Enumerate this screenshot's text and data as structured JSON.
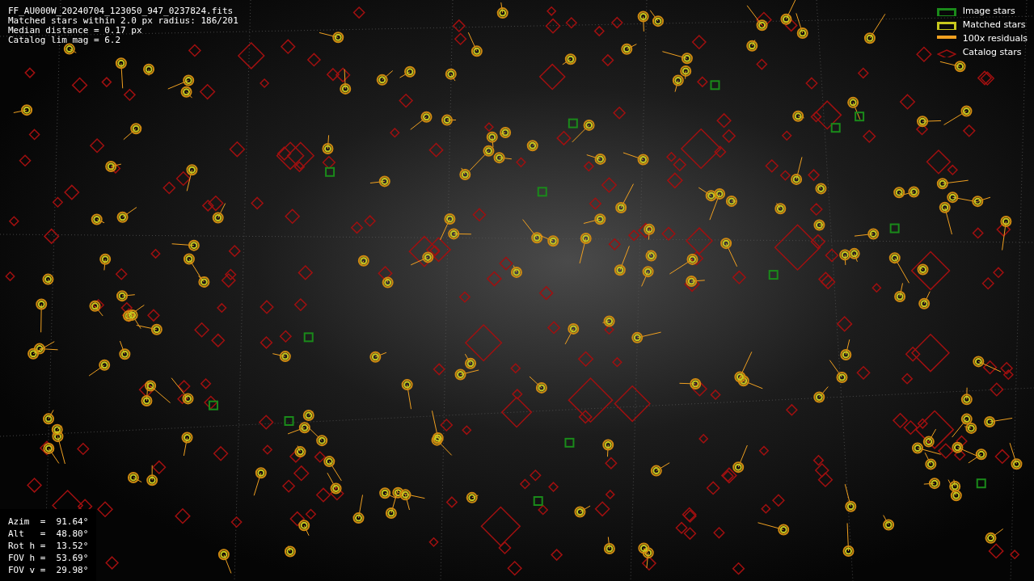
{
  "header_lines": [
    "FF_AU000W_20240704_123050_947_0237824.fits",
    "Matched stars within 2.0 px radius: 186/201",
    "Median distance = 0.17 px",
    "Catalog lim mag = 6.2"
  ],
  "legend": [
    {
      "kind": "image",
      "label": "Image stars",
      "color": "#1a8a1a"
    },
    {
      "kind": "matched",
      "label": "Matched stars",
      "color": "#c8c81e"
    },
    {
      "kind": "residual",
      "label": "100x residuals",
      "color": "#f0a020"
    },
    {
      "kind": "catalog",
      "label": "Catalog stars",
      "color": "#a01010"
    }
  ],
  "pointing": [
    "Azim  =  91.64°",
    "Alt   =  48.80°",
    "Rot h =  13.52°",
    "FOV h =  53.69°",
    "FOV v =  29.98°"
  ]
}
